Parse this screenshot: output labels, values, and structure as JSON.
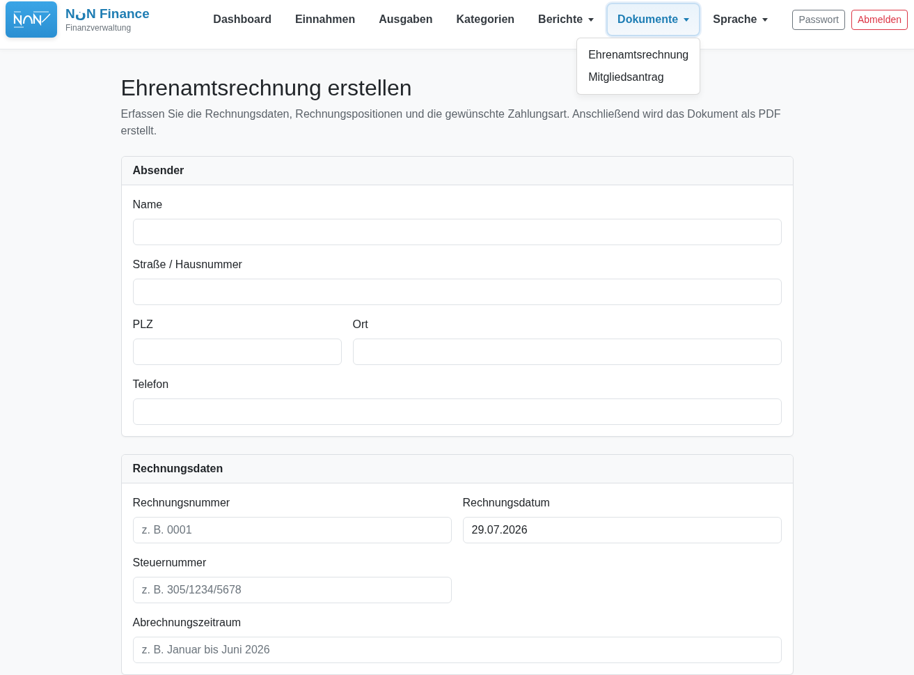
{
  "brand": {
    "name": "NنN Finance",
    "subtitle": "Finanzverwaltung"
  },
  "nav": {
    "items": [
      {
        "label": "Dashboard",
        "kind": "link",
        "selected": false
      },
      {
        "label": "Einnahmen",
        "kind": "link",
        "selected": false
      },
      {
        "label": "Ausgaben",
        "kind": "link",
        "selected": false
      },
      {
        "label": "Kategorien",
        "kind": "link",
        "selected": false
      },
      {
        "label": "Berichte",
        "kind": "dropdown",
        "selected": false,
        "expanded": false
      },
      {
        "label": "Dokumente",
        "kind": "dropdown",
        "selected": true,
        "expanded": true,
        "menu": [
          {
            "label": "Ehrenamtsrechnung"
          },
          {
            "label": "Mitgliedsantrag"
          }
        ]
      },
      {
        "label": "Sprache",
        "kind": "dropdown",
        "selected": false,
        "expanded": false
      }
    ],
    "buttons": [
      {
        "label": "Passwort",
        "kind": "secondary"
      },
      {
        "label": "Abmelden",
        "kind": "danger"
      }
    ]
  },
  "page": {
    "title": "Ehrenamtsrechnung erstellen",
    "description": "Erfassen Sie die Rechnungsdaten, Rechnungspositionen und die gewünschte Zahlungsart. Anschließend wird das Dokument als PDF erstellt."
  },
  "cards": [
    {
      "title": "Absender",
      "fields": [
        {
          "label": "Name"
        },
        {
          "label": "Straße / Hausnummer"
        },
        {
          "label": "PLZ"
        },
        {
          "label": "Ort"
        },
        {
          "label": "Telefon"
        }
      ]
    },
    {
      "title": "Rechnungsdaten",
      "fields": [
        {
          "label": "Rechnungsnummer",
          "placeholder": "z. B. 0001"
        },
        {
          "label": "Rechnungsdatum",
          "value": "29.07.2026"
        },
        {
          "label": "Steuernummer",
          "placeholder": "z. B. 305/1234/5678"
        },
        {
          "label": "Abrechnungszeitraum",
          "placeholder": "z. B. Januar bis Juni 2026"
        }
      ]
    }
  ]
}
